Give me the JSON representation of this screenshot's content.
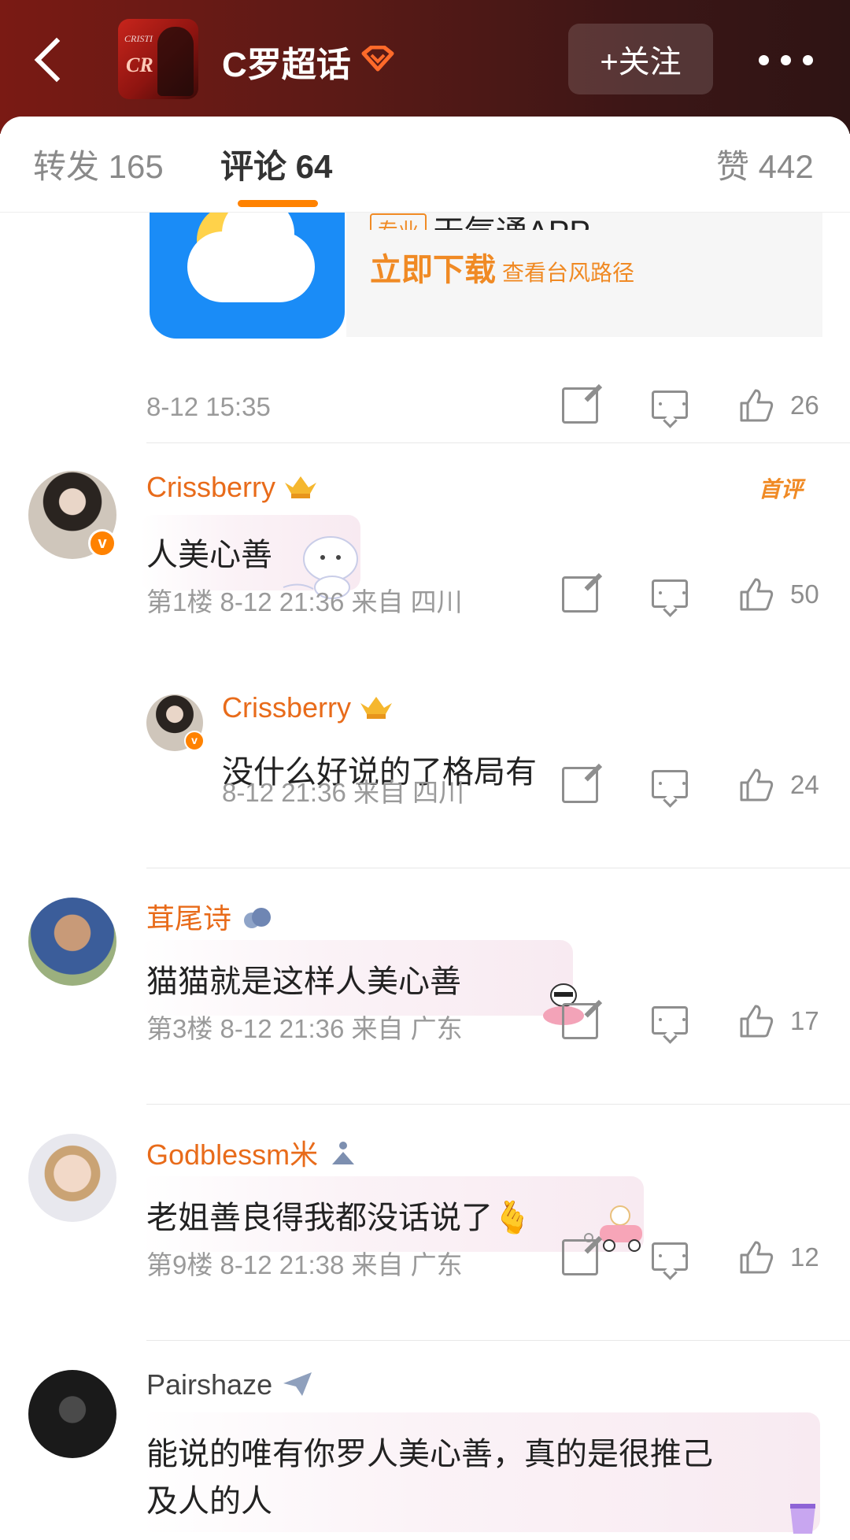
{
  "header": {
    "title": "C罗超话",
    "follow_label": "+关注"
  },
  "tabs": [
    {
      "label": "转发 165"
    },
    {
      "label": "评论 64"
    },
    {
      "label": "赞 442"
    }
  ],
  "ad": {
    "tag": "专业",
    "app_name": "天气通APP",
    "download": "立即下载",
    "sub": "查看台风路径"
  },
  "prev_meta": {
    "time": "8-12 15:35",
    "likes": "26"
  },
  "comments": [
    {
      "user": "Crissberry",
      "hot_label": "首评",
      "text": "人美心善",
      "meta": "第1楼  8-12 21:36  来自 四川",
      "likes": "50",
      "reply": {
        "user": "Crissberry",
        "text": "没什么好说的了格局有",
        "meta": "8-12 21:36  来自 四川",
        "likes": "24"
      }
    },
    {
      "user": "茸尾诗",
      "text": "猫猫就是这样人美心善",
      "meta": "第3楼  8-12 21:36  来自 广东",
      "likes": "17"
    },
    {
      "user": "Godblessm米",
      "text": "老姐善良得我都没话说了🫰",
      "meta": "第9楼  8-12 21:38  来自 广东",
      "likes": "12"
    },
    {
      "user": "Pairshaze",
      "text_line1": "能说的唯有你罗人美心善，真的是很推己",
      "text_line2": "及人的人"
    }
  ],
  "colors": {
    "accent": "#ff8200",
    "username": "#e86b1a",
    "header_bg": "#5b1a16"
  }
}
